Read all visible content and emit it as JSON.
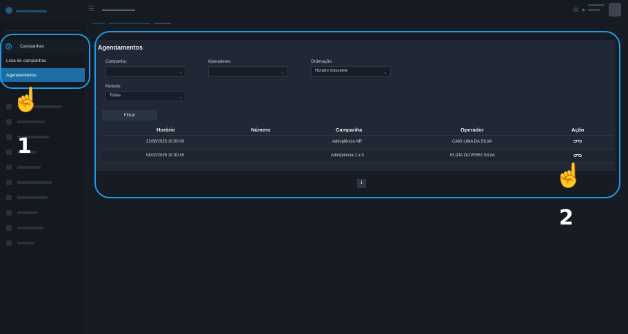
{
  "sidebar": {
    "section_label": "Campanhas",
    "items": [
      {
        "label": "Lista de campanhas"
      },
      {
        "label": "Agendamentos"
      }
    ]
  },
  "page": {
    "title": "Agendamentos"
  },
  "filters": {
    "campanha": {
      "label": "Campanha:",
      "value": ""
    },
    "operadores": {
      "label": "Operadores:",
      "value": ""
    },
    "ordenacao": {
      "label": "Ordenação:",
      "value": "Horario crescente"
    },
    "periodo": {
      "label": "Período:",
      "value": "Todas"
    },
    "submit_label": "Filtrar"
  },
  "table": {
    "columns": [
      "Horário",
      "Número",
      "Campanha",
      "Operador",
      "Ação"
    ],
    "rows": [
      {
        "horario": "22/08/2025 10:00:00",
        "numero": "",
        "campanha": "Adimplência NR",
        "operador": "CAIO LIMA DA SILVA",
        "acao_icon": "view-glasses-icon"
      },
      {
        "horario": "08/10/2025 10:30:45",
        "numero": "",
        "campanha": "Adimplência 1 a 3",
        "operador": "ELIZIA OLIVEIRA SILVA",
        "acao_icon": "view-glasses-icon"
      }
    ]
  },
  "pagination": {
    "current": "1"
  },
  "annotations": {
    "step1": "1",
    "step2": "2",
    "highlight_color": "#1e9ce8"
  }
}
